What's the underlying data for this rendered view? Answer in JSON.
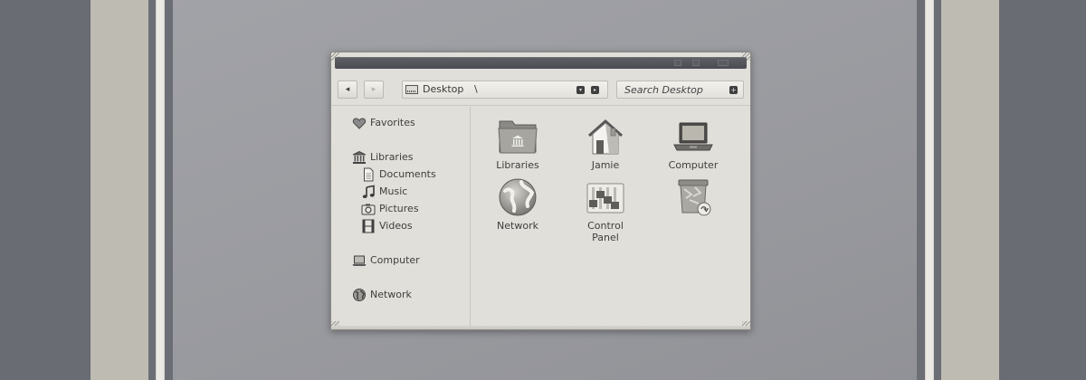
{
  "window": {
    "title": ""
  },
  "toolbar": {
    "back_icon": "back-arrow-icon",
    "forward_icon": "forward-arrow-icon",
    "back_glyph": "◂",
    "forward_glyph": "▸",
    "address_text": "Desktop",
    "address_separator": "\\",
    "address_dropdown_glyph": "▾",
    "address_go_glyph": "▸",
    "search_placeholder": "Search Desktop",
    "search_go_glyph": "+"
  },
  "sidebar": {
    "items": [
      {
        "label": "Favorites",
        "icon": "heart-icon"
      },
      {
        "label": "Libraries",
        "icon": "library-icon"
      },
      {
        "label": "Documents",
        "icon": "document-icon"
      },
      {
        "label": "Music",
        "icon": "music-note-icon"
      },
      {
        "label": "Pictures",
        "icon": "camera-icon"
      },
      {
        "label": "Videos",
        "icon": "film-icon"
      },
      {
        "label": "Computer",
        "icon": "laptop-icon"
      },
      {
        "label": "Network",
        "icon": "globe-icon"
      }
    ]
  },
  "content": {
    "items": [
      {
        "label": "Libraries",
        "icon": "library-folder-icon"
      },
      {
        "label": "Jamie",
        "icon": "home-icon"
      },
      {
        "label": "Computer",
        "icon": "laptop-icon"
      },
      {
        "label": "Network",
        "icon": "globe-icon"
      },
      {
        "label": "Control\nPanel",
        "label_lines": [
          "Control",
          "Panel"
        ],
        "icon": "control-panel-icon"
      },
      {
        "label": "",
        "icon": "recycle-bin-icon"
      }
    ]
  },
  "colors": {
    "window_bg": "#e1dfd9",
    "titlebar": "#55565c",
    "text": "#3e3e3e",
    "wallpaper": "#9b9ca1",
    "stripe_dark": "#6a6c74",
    "stripe_beige": "#bebbb3"
  }
}
